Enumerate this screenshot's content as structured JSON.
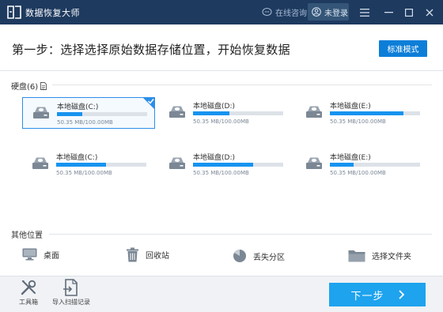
{
  "titlebar": {
    "app_title": "数据恢复大师",
    "online_label": "在线咨询",
    "login_label": "未登录"
  },
  "header": {
    "step_title": "第一步：选择选择原始数据存储位置，开始恢复数据",
    "mode_button": "标准模式"
  },
  "disks": {
    "section_label": "硬盘(6)",
    "items": [
      {
        "name": "本地磁盘(C:)",
        "size": "50.35 MB/100.00MB",
        "used_fraction": 0.28,
        "selected": true
      },
      {
        "name": "本地磁盘(D:)",
        "size": "50.35 MB/100.00MB",
        "used_fraction": 0.4,
        "selected": false
      },
      {
        "name": "本地磁盘(E:)",
        "size": "50.35 MB/100.00MB",
        "used_fraction": 0.82,
        "selected": false
      },
      {
        "name": "本地磁盘(C:)",
        "size": "50.35 MB/100.00MB",
        "used_fraction": 0.55,
        "selected": false
      },
      {
        "name": "本地磁盘(D:)",
        "size": "50.35 MB/100.00MB",
        "used_fraction": 0.67,
        "selected": false
      },
      {
        "name": "本地磁盘(E:)",
        "size": "50.35 MB/100.00MB",
        "used_fraction": 0.26,
        "selected": false
      }
    ]
  },
  "other": {
    "section_label": "其他位置",
    "items": [
      {
        "label": "桌面",
        "icon": "monitor-icon"
      },
      {
        "label": "回收站",
        "icon": "trash-icon"
      },
      {
        "label": "丢失分区",
        "icon": "pie-icon"
      },
      {
        "label": "选择文件夹",
        "icon": "folder-icon"
      }
    ]
  },
  "footer": {
    "toolbox_label": "工具箱",
    "import_label": "导入扫描记录",
    "next_label": "下一步"
  },
  "colors": {
    "titlebar": "#1e3a5f",
    "accent": "#1793ef",
    "next_button": "#1ea3ee",
    "mode_button": "#0d7ed8"
  }
}
